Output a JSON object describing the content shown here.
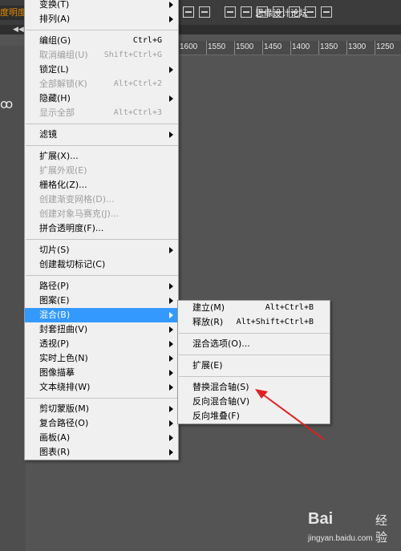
{
  "app": {
    "left_label": "度明度",
    "site_title": "思缘设计论坛",
    "ruler_labels": [
      "1600",
      "1550",
      "1500",
      "1450",
      "1400",
      "1350",
      "1300",
      "1250"
    ],
    "collapse_glyph": "◀◀"
  },
  "main_menu": {
    "items": [
      {
        "label": "变换(T)",
        "type": "sub"
      },
      {
        "label": "排列(A)",
        "type": "sub"
      },
      {
        "type": "sep"
      },
      {
        "label": "编组(G)",
        "shortcut": "Ctrl+G"
      },
      {
        "label": "取消编组(U)",
        "shortcut": "Shift+Ctrl+G",
        "disabled": true
      },
      {
        "label": "锁定(L)",
        "type": "sub"
      },
      {
        "label": "全部解锁(K)",
        "shortcut": "Alt+Ctrl+2",
        "disabled": true
      },
      {
        "label": "隐藏(H)",
        "type": "sub"
      },
      {
        "label": "显示全部",
        "shortcut": "Alt+Ctrl+3",
        "disabled": true
      },
      {
        "type": "sep"
      },
      {
        "label": "滤镜",
        "type": "sub"
      },
      {
        "type": "sep"
      },
      {
        "label": "扩展(X)..."
      },
      {
        "label": "扩展外观(E)",
        "disabled": true
      },
      {
        "label": "栅格化(Z)..."
      },
      {
        "label": "创建渐变网格(D)...",
        "disabled": true
      },
      {
        "label": "创建对象马赛克(J)...",
        "disabled": true
      },
      {
        "label": "拼合透明度(F)..."
      },
      {
        "type": "sep"
      },
      {
        "label": "切片(S)",
        "type": "sub"
      },
      {
        "label": "创建裁切标记(C)"
      },
      {
        "type": "sep"
      },
      {
        "label": "路径(P)",
        "type": "sub"
      },
      {
        "label": "图案(E)",
        "type": "sub"
      },
      {
        "label": "混合(B)",
        "type": "sub",
        "highlighted": true
      },
      {
        "label": "封套扭曲(V)",
        "type": "sub"
      },
      {
        "label": "透视(P)",
        "type": "sub"
      },
      {
        "label": "实时上色(N)",
        "type": "sub"
      },
      {
        "label": "图像描摹",
        "type": "sub"
      },
      {
        "label": "文本绕排(W)",
        "type": "sub"
      },
      {
        "type": "sep"
      },
      {
        "label": "剪切蒙版(M)",
        "type": "sub"
      },
      {
        "label": "复合路径(O)",
        "type": "sub"
      },
      {
        "label": "画板(A)",
        "type": "sub"
      },
      {
        "label": "图表(R)",
        "type": "sub"
      }
    ]
  },
  "blend_submenu": {
    "items": [
      {
        "label": "建立(M)",
        "shortcut": "Alt+Ctrl+B"
      },
      {
        "label": "释放(R)",
        "shortcut": "Alt+Shift+Ctrl+B"
      },
      {
        "type": "sep"
      },
      {
        "label": "混合选项(O)..."
      },
      {
        "type": "sep"
      },
      {
        "label": "扩展(E)"
      },
      {
        "type": "sep"
      },
      {
        "label": "替换混合轴(S)"
      },
      {
        "label": "反向混合轴(V)"
      },
      {
        "label": "反向堆叠(F)"
      }
    ]
  },
  "annotation": {
    "color": "#e02020"
  },
  "watermark": {
    "logo": "Bai",
    "logo_suffix": "经验",
    "url": "jingyan.baidu.com"
  },
  "colors": {
    "highlight": "#3399ff",
    "menu_bg": "#f0f0f0",
    "canvas_bg": "#545454"
  }
}
